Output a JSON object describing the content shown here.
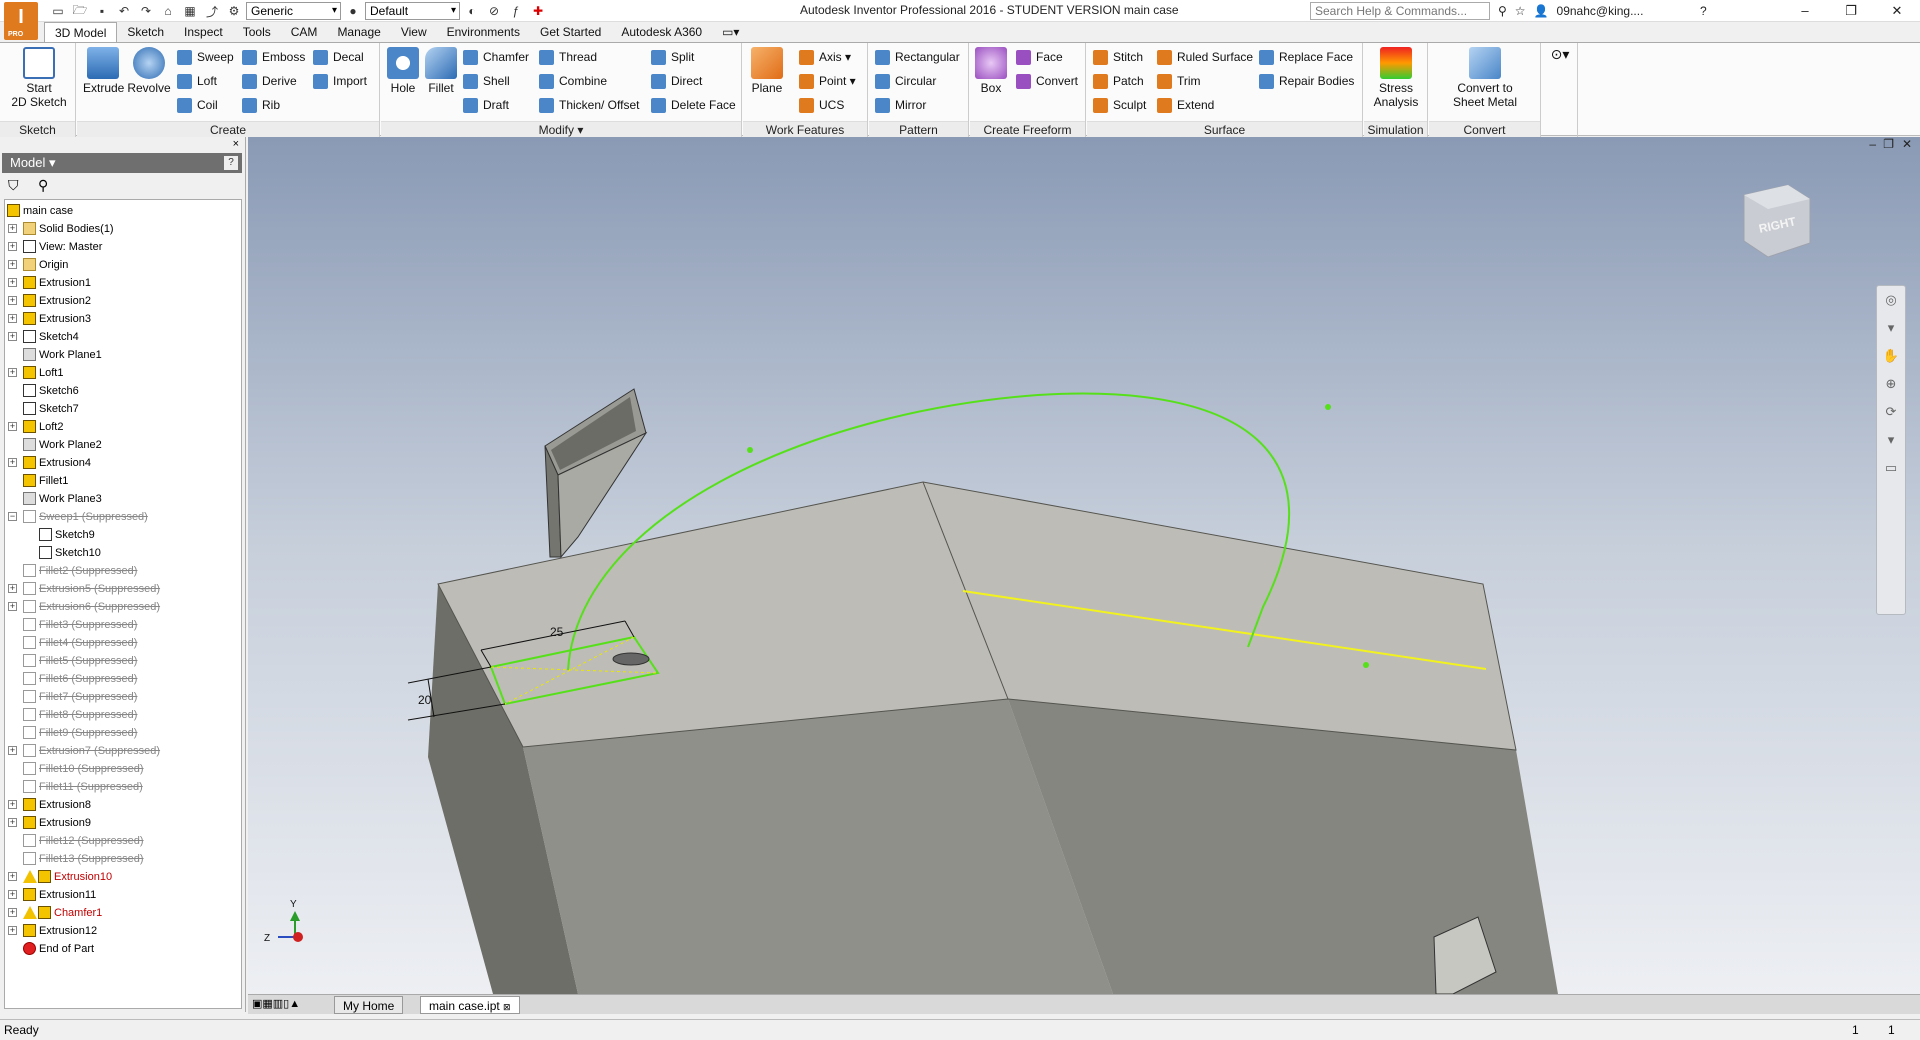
{
  "titlebar": {
    "app_title": "Autodesk Inventor Professional 2016 - STUDENT VERSION   main case",
    "app_logo": "I",
    "app_logo_sub": "PRO",
    "material_combo": "Generic",
    "appearance_combo": "Default",
    "search_placeholder": "Search Help & Commands...",
    "user": "09nahc@king....",
    "help": "?"
  },
  "tabs": [
    "3D Model",
    "Sketch",
    "Inspect",
    "Tools",
    "CAM",
    "Manage",
    "View",
    "Environments",
    "Get Started",
    "Autodesk A360"
  ],
  "ribbon": {
    "sketch": {
      "title": "Sketch",
      "start_sketch": "Start",
      "start_sketch2": "2D Sketch"
    },
    "create": {
      "title": "Create",
      "extrude": "Extrude",
      "revolve": "Revolve",
      "sweep": "Sweep",
      "loft": "Loft",
      "coil": "Coil",
      "emboss": "Emboss",
      "derive": "Derive",
      "rib": "Rib",
      "decal": "Decal",
      "import": "Import"
    },
    "modify": {
      "title": "Modify ▾",
      "hole": "Hole",
      "fillet": "Fillet",
      "chamfer": "Chamfer",
      "shell": "Shell",
      "draft": "Draft",
      "thread": "Thread",
      "combine": "Combine",
      "thicken": "Thicken/ Offset",
      "split": "Split",
      "direct": "Direct",
      "delete_face": "Delete Face"
    },
    "work": {
      "title": "Work Features",
      "plane": "Plane",
      "axis": "Axis ▾",
      "point": "Point ▾",
      "ucs": "UCS"
    },
    "pattern": {
      "title": "Pattern",
      "rectangular": "Rectangular",
      "circular": "Circular",
      "mirror": "Mirror"
    },
    "freeform": {
      "title": "Create Freeform",
      "box": "Box",
      "face": "Face",
      "convert": "Convert"
    },
    "surface": {
      "title": "Surface",
      "stitch": "Stitch",
      "patch": "Patch",
      "sculpt": "Sculpt",
      "ruled": "Ruled Surface",
      "trim": "Trim",
      "extend": "Extend",
      "replace": "Replace Face",
      "repair": "Repair Bodies"
    },
    "simulation": {
      "title": "Simulation",
      "stress": "Stress",
      "stress2": "Analysis"
    },
    "convert": {
      "title": "Convert",
      "sheet": "Convert to",
      "sheet2": "Sheet Metal"
    }
  },
  "browser": {
    "header": "Model ▾",
    "help_icon": "?",
    "close": "×",
    "nodes": [
      {
        "label": "main case",
        "icon": "part"
      },
      {
        "label": "Solid Bodies(1)",
        "icon": "folder"
      },
      {
        "label": "View: Master",
        "icon": "sketch"
      },
      {
        "label": "Origin",
        "icon": "folder"
      },
      {
        "label": "Extrusion1",
        "icon": "feature"
      },
      {
        "label": "Extrusion2",
        "icon": "feature"
      },
      {
        "label": "Extrusion3",
        "icon": "feature"
      },
      {
        "label": "Sketch4",
        "icon": "sketch"
      },
      {
        "label": "Work Plane1",
        "icon": "plane"
      },
      {
        "label": "Loft1",
        "icon": "feature"
      },
      {
        "label": "Sketch6",
        "icon": "sketch"
      },
      {
        "label": "Sketch7",
        "icon": "sketch"
      },
      {
        "label": "Loft2",
        "icon": "feature"
      },
      {
        "label": "Work Plane2",
        "icon": "plane"
      },
      {
        "label": "Extrusion4",
        "icon": "feature"
      },
      {
        "label": "Fillet1",
        "icon": "feature"
      },
      {
        "label": "Work Plane3",
        "icon": "plane"
      },
      {
        "label": "Sweep1 (Suppressed)",
        "icon": "suppressed"
      },
      {
        "label": "Sketch9",
        "icon": "sketch"
      },
      {
        "label": "Sketch10",
        "icon": "sketch"
      },
      {
        "label": "Fillet2 (Suppressed)",
        "icon": "suppressed"
      },
      {
        "label": "Extrusion5 (Suppressed)",
        "icon": "suppressed"
      },
      {
        "label": "Extrusion6 (Suppressed)",
        "icon": "suppressed"
      },
      {
        "label": "Fillet3 (Suppressed)",
        "icon": "suppressed"
      },
      {
        "label": "Fillet4 (Suppressed)",
        "icon": "suppressed"
      },
      {
        "label": "Fillet5 (Suppressed)",
        "icon": "suppressed"
      },
      {
        "label": "Fillet6 (Suppressed)",
        "icon": "suppressed"
      },
      {
        "label": "Fillet7 (Suppressed)",
        "icon": "suppressed"
      },
      {
        "label": "Fillet8 (Suppressed)",
        "icon": "suppressed"
      },
      {
        "label": "Fillet9 (Suppressed)",
        "icon": "suppressed"
      },
      {
        "label": "Extrusion7 (Suppressed)",
        "icon": "suppressed"
      },
      {
        "label": "Fillet10 (Suppressed)",
        "icon": "suppressed"
      },
      {
        "label": "Fillet11 (Suppressed)",
        "icon": "suppressed"
      },
      {
        "label": "Extrusion8",
        "icon": "feature"
      },
      {
        "label": "Extrusion9",
        "icon": "feature"
      },
      {
        "label": "Fillet12 (Suppressed)",
        "icon": "suppressed"
      },
      {
        "label": "Fillet13 (Suppressed)",
        "icon": "suppressed"
      },
      {
        "label": "Extrusion10",
        "icon": "error"
      },
      {
        "label": "Extrusion11",
        "icon": "feature"
      },
      {
        "label": "Chamfer1",
        "icon": "error"
      },
      {
        "label": "Extrusion12",
        "icon": "feature"
      },
      {
        "label": "End of Part",
        "icon": "end"
      }
    ]
  },
  "viewport": {
    "viewcube_label": "RIGHT",
    "dim_horizontal": "25",
    "dim_vertical": "20",
    "axis_y": "Y",
    "axis_z": "Z",
    "colors": {
      "path_green": "#56e01a",
      "edge_yellow": "#f2f21e",
      "body_top": "#bcbbb6",
      "body_side": "#8d8d86"
    }
  },
  "doc_tabs": {
    "home": "My Home",
    "active": "main case.ipt"
  },
  "status": {
    "text": "Ready",
    "count1": "1",
    "count2": "1"
  }
}
